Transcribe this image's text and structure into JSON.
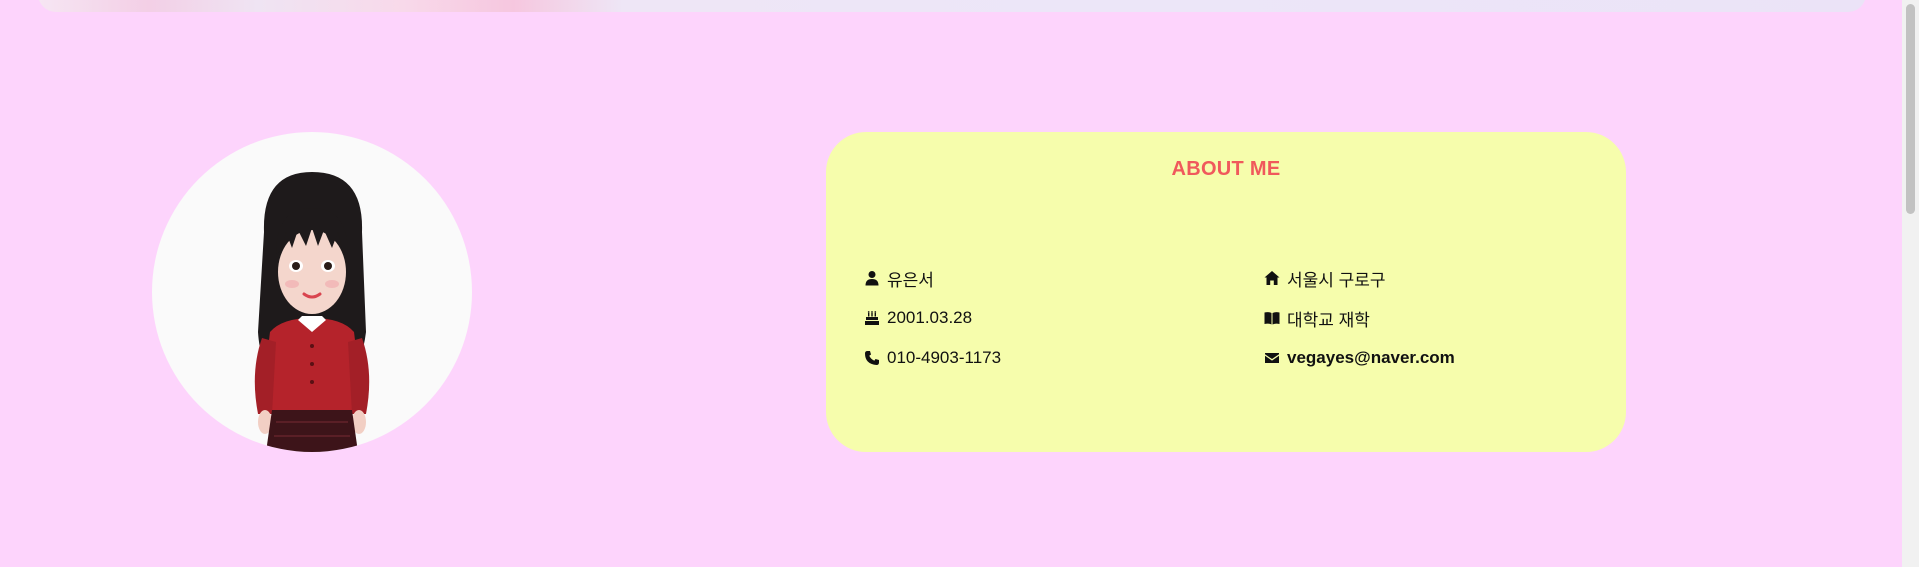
{
  "about": {
    "title": "ABOUT ME",
    "left_column": [
      {
        "icon": "user-icon",
        "text": "유은서"
      },
      {
        "icon": "birthday-cake-icon",
        "text": "2001.03.28"
      },
      {
        "icon": "phone-icon",
        "text": "010-4903-1173"
      }
    ],
    "right_column": [
      {
        "icon": "home-icon",
        "text": "서울시 구로구"
      },
      {
        "icon": "book-icon",
        "text": "대학교 재학"
      },
      {
        "icon": "envelope-icon",
        "text": "vegayes@naver.com"
      }
    ]
  },
  "colors": {
    "page_background": "#fdd4fc",
    "card_background": "#f6fdac",
    "title_color": "#f0595c"
  }
}
